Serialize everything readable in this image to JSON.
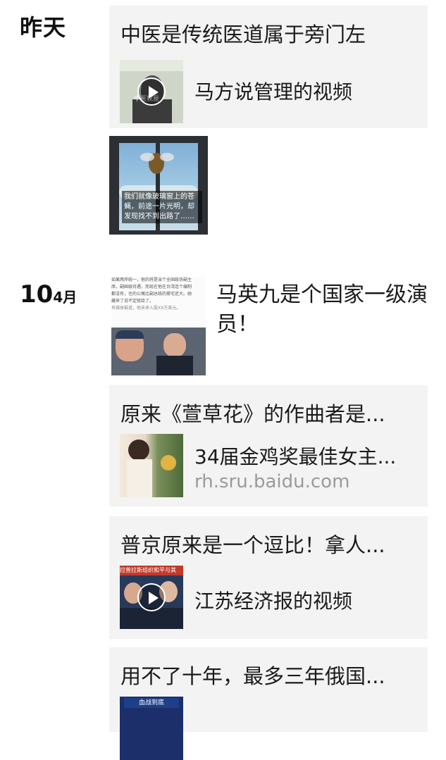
{
  "groups": [
    {
      "date_label": "昨天",
      "items": [
        {
          "type": "share_card",
          "title": "中医是传统医道属于旁门左",
          "subtitle": "马方说管理的视频",
          "thumb_kind": "video",
          "thumb_text": "中医就是"
        },
        {
          "type": "image_post",
          "overlay_caption": "我们就像玻璃窗上的苍蝇，前途一片光明，却发现找不到出路了……"
        }
      ]
    },
    {
      "date_day": "10",
      "date_month": "4月",
      "items": [
        {
          "type": "image_text_post",
          "text": "马英九是个国家一级演员！",
          "image_caption_lines": [
            "如果两岸统一，他的将是当个全国政协副主",
            "席，副国级待遇，而现在他在台湾连个编制",
            "都没有，住的公寓比副总统的豪宅还大。她",
            "藏来了说不定就给了。",
            "有媒体报道，他未来入股XX万美元。"
          ]
        },
        {
          "type": "share_card",
          "title": "原来《萱草花》的作曲者是...",
          "subtitle": "34届金鸡奖最佳女主...",
          "url": "rh.sru.baidu.com",
          "thumb_kind": "photo"
        },
        {
          "type": "share_card",
          "title": "普京原来是一个逗比！拿人...",
          "subtitle": "江苏经济报的视频",
          "thumb_kind": "video",
          "thumb_text": "拉普拉斯组织和平与其"
        },
        {
          "type": "share_card",
          "title": "用不了十年，最多三年俄国...",
          "thumb_kind": "video",
          "thumb_text": "血战到底"
        }
      ]
    }
  ]
}
